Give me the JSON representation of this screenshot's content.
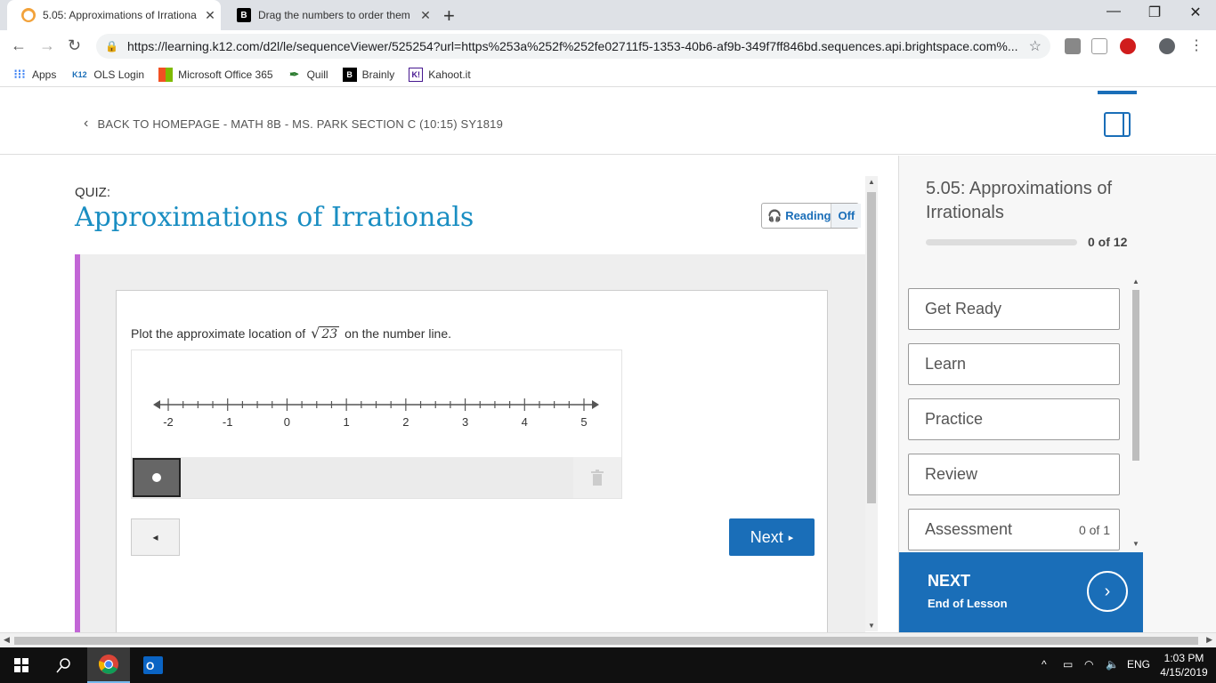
{
  "browser": {
    "tabs": [
      {
        "title": "5.05: Approximations of Irrationa",
        "favicon": "k12-icon",
        "active": true
      },
      {
        "title": "Drag the numbers to order them",
        "favicon": "brainly-icon",
        "active": false
      }
    ],
    "new_tab": "+",
    "window_controls": {
      "minimize": "—",
      "maximize": "❐",
      "close": "✕"
    },
    "nav": {
      "back": "←",
      "forward": "→",
      "reload": "↻"
    },
    "url": "https://learning.k12.com/d2l/le/sequenceViewer/525254?url=https%253a%252f%252fe02711f5-1353-40b6-af9b-349f7ff846bd.sequences.api.brightspace.com%...",
    "bookmarks": [
      {
        "label": "Apps",
        "icon": "apps-grid-icon"
      },
      {
        "label": "OLS Login",
        "icon": "k12-icon",
        "badge": "K12"
      },
      {
        "label": "Microsoft Office 365",
        "icon": "office-icon"
      },
      {
        "label": "Quill",
        "icon": "quill-icon"
      },
      {
        "label": "Brainly",
        "icon": "brainly-icon",
        "badge": "B"
      },
      {
        "label": "Kahoot.it",
        "icon": "kahoot-icon",
        "badge": "K!"
      }
    ]
  },
  "header": {
    "back_link": "BACK TO HOMEPAGE - MATH 8B - MS. PARK SECTION C (10:15) SY1819"
  },
  "quiz": {
    "label": "QUIZ:",
    "title": "Approximations of Irrationals",
    "reading_label": "Reading",
    "reading_state": "Off",
    "prompt_before": "Plot the approximate location of",
    "prompt_radicand": "23",
    "prompt_after": "on the number line.",
    "number_line": {
      "min": -2,
      "max": 5,
      "minor_ticks_per_unit": 4,
      "labels": [
        "-2",
        "-1",
        "0",
        "1",
        "2",
        "3",
        "4",
        "5"
      ]
    },
    "prev_button": "◂",
    "next_button": "Next",
    "next_arrow": "▸"
  },
  "sidebar": {
    "title": "5.05: Approximations of Irrationals",
    "progress_text": "0 of 12",
    "progress_fraction": 0,
    "items": [
      {
        "label": "Get Ready",
        "count": ""
      },
      {
        "label": "Learn",
        "count": ""
      },
      {
        "label": "Practice",
        "count": ""
      },
      {
        "label": "Review",
        "count": ""
      },
      {
        "label": "Assessment",
        "count": "0 of 1"
      }
    ],
    "next_title": "NEXT",
    "next_subtitle": "End of Lesson",
    "next_arrow": "›"
  },
  "taskbar": {
    "language": "ENG",
    "time": "1:03 PM",
    "date": "4/15/2019"
  },
  "colors": {
    "accent": "#1a6eb8",
    "title_blue": "#1a8ec2",
    "quiz_border": "#c266d6"
  }
}
